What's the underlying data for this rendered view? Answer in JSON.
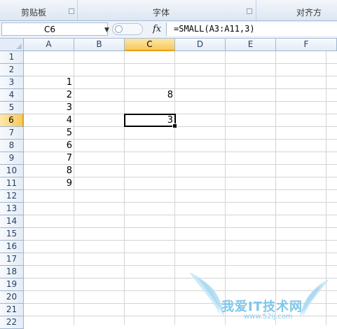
{
  "ribbon": {
    "groups": [
      {
        "label": "剪贴板"
      },
      {
        "label": "字体"
      },
      {
        "label": "对齐方"
      }
    ]
  },
  "formula_bar": {
    "name_box": "C6",
    "fx_label": "fx",
    "formula": "=SMALL(A3:A11,3)"
  },
  "sheet": {
    "columns": [
      "A",
      "B",
      "C",
      "D",
      "E",
      "F"
    ],
    "selected_column": "C",
    "rows": [
      "1",
      "2",
      "3",
      "4",
      "5",
      "6",
      "7",
      "8",
      "9",
      "10",
      "11",
      "12",
      "13",
      "14",
      "15",
      "16",
      "17",
      "18",
      "19",
      "20",
      "21",
      "22"
    ],
    "selected_row": "6",
    "cells": {
      "A3": "1",
      "A4": "2",
      "A5": "3",
      "A6": "4",
      "A7": "5",
      "A8": "6",
      "A9": "7",
      "A10": "8",
      "A11": "9",
      "C4": "8",
      "C6": "3"
    },
    "active_cell": "C6"
  },
  "watermark": {
    "text": "我爱IT技术网",
    "url": "www.52ij.com"
  },
  "colors": {
    "header_selected": "#f9c85c",
    "header_bg": "#e4ecf7",
    "gridline": "#d4d4d4",
    "watermark": "#7fc6ea"
  }
}
